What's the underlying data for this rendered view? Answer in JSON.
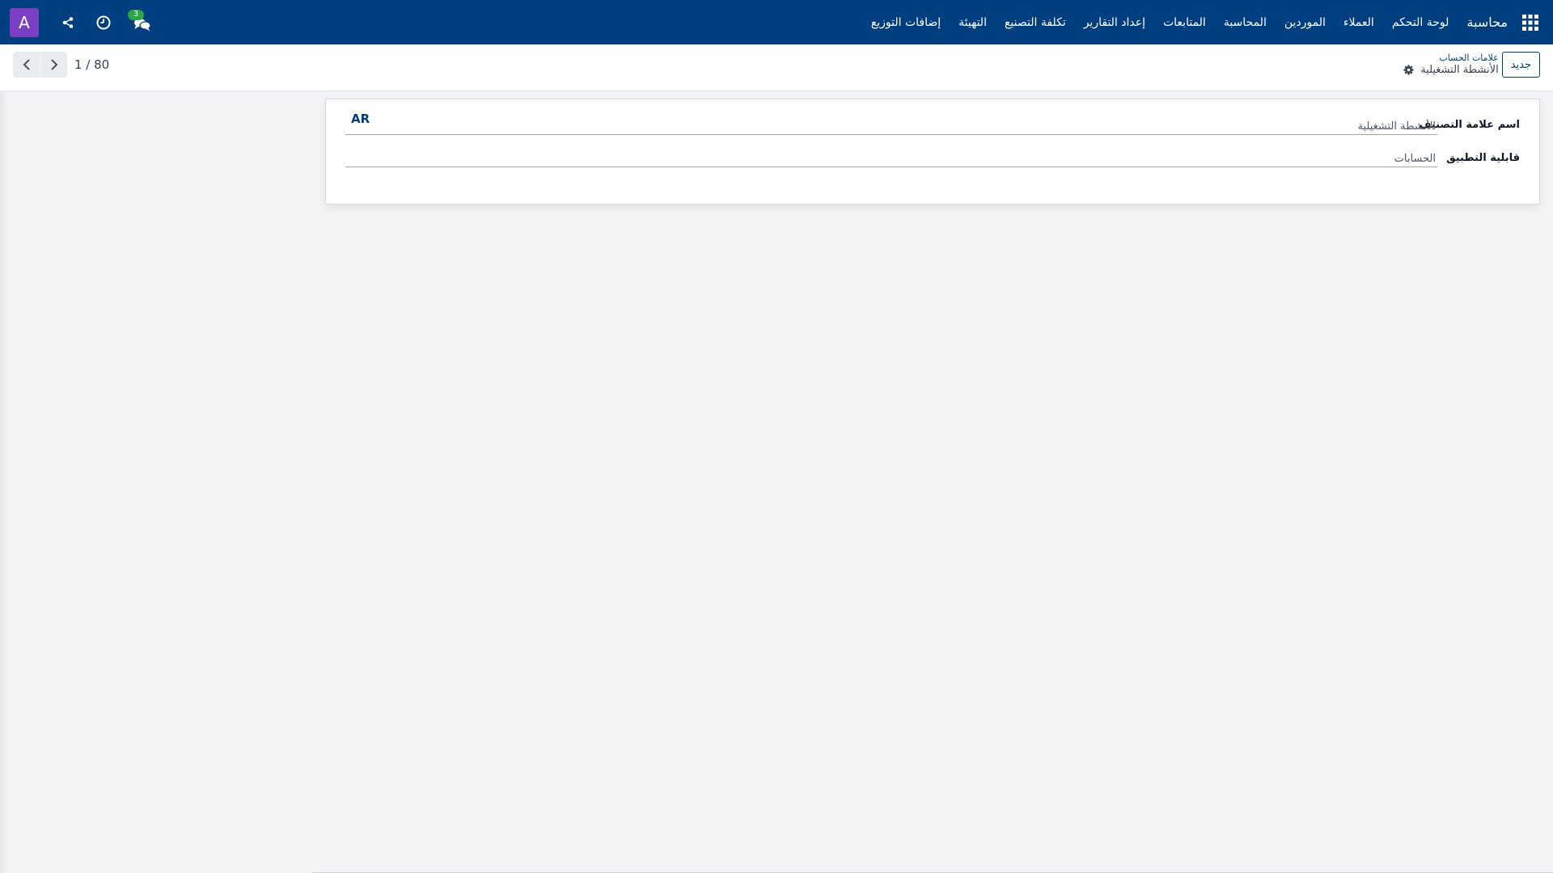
{
  "navbar": {
    "app_name": "محاسبة",
    "menu": [
      "لوحة التحكم",
      "العملاء",
      "الموردين",
      "المحاسبة",
      "المتابعات",
      "إعداد التقارير",
      "تكلفة التصنيع",
      "التهيئة",
      "إضافات التوزيع"
    ],
    "avatar_letter": "A",
    "chat_count": "3",
    "icons": [
      "apps-grid-icon",
      "chat-icon",
      "clock-icon",
      "share-icon"
    ],
    "bg_color": "#003f7f"
  },
  "control_panel": {
    "new_button": "جديد",
    "breadcrumb_parent": "علامات الحساب",
    "breadcrumb_current": "الأنشطة التشغيلية",
    "pager": "1 / 80"
  },
  "form": {
    "fields": [
      {
        "label": "اسم علامة التصنيف",
        "value": "الأنشطة التشغيلية",
        "lang": "AR"
      },
      {
        "label": "قابلية التطبيق",
        "value": "الحسابات"
      }
    ]
  }
}
